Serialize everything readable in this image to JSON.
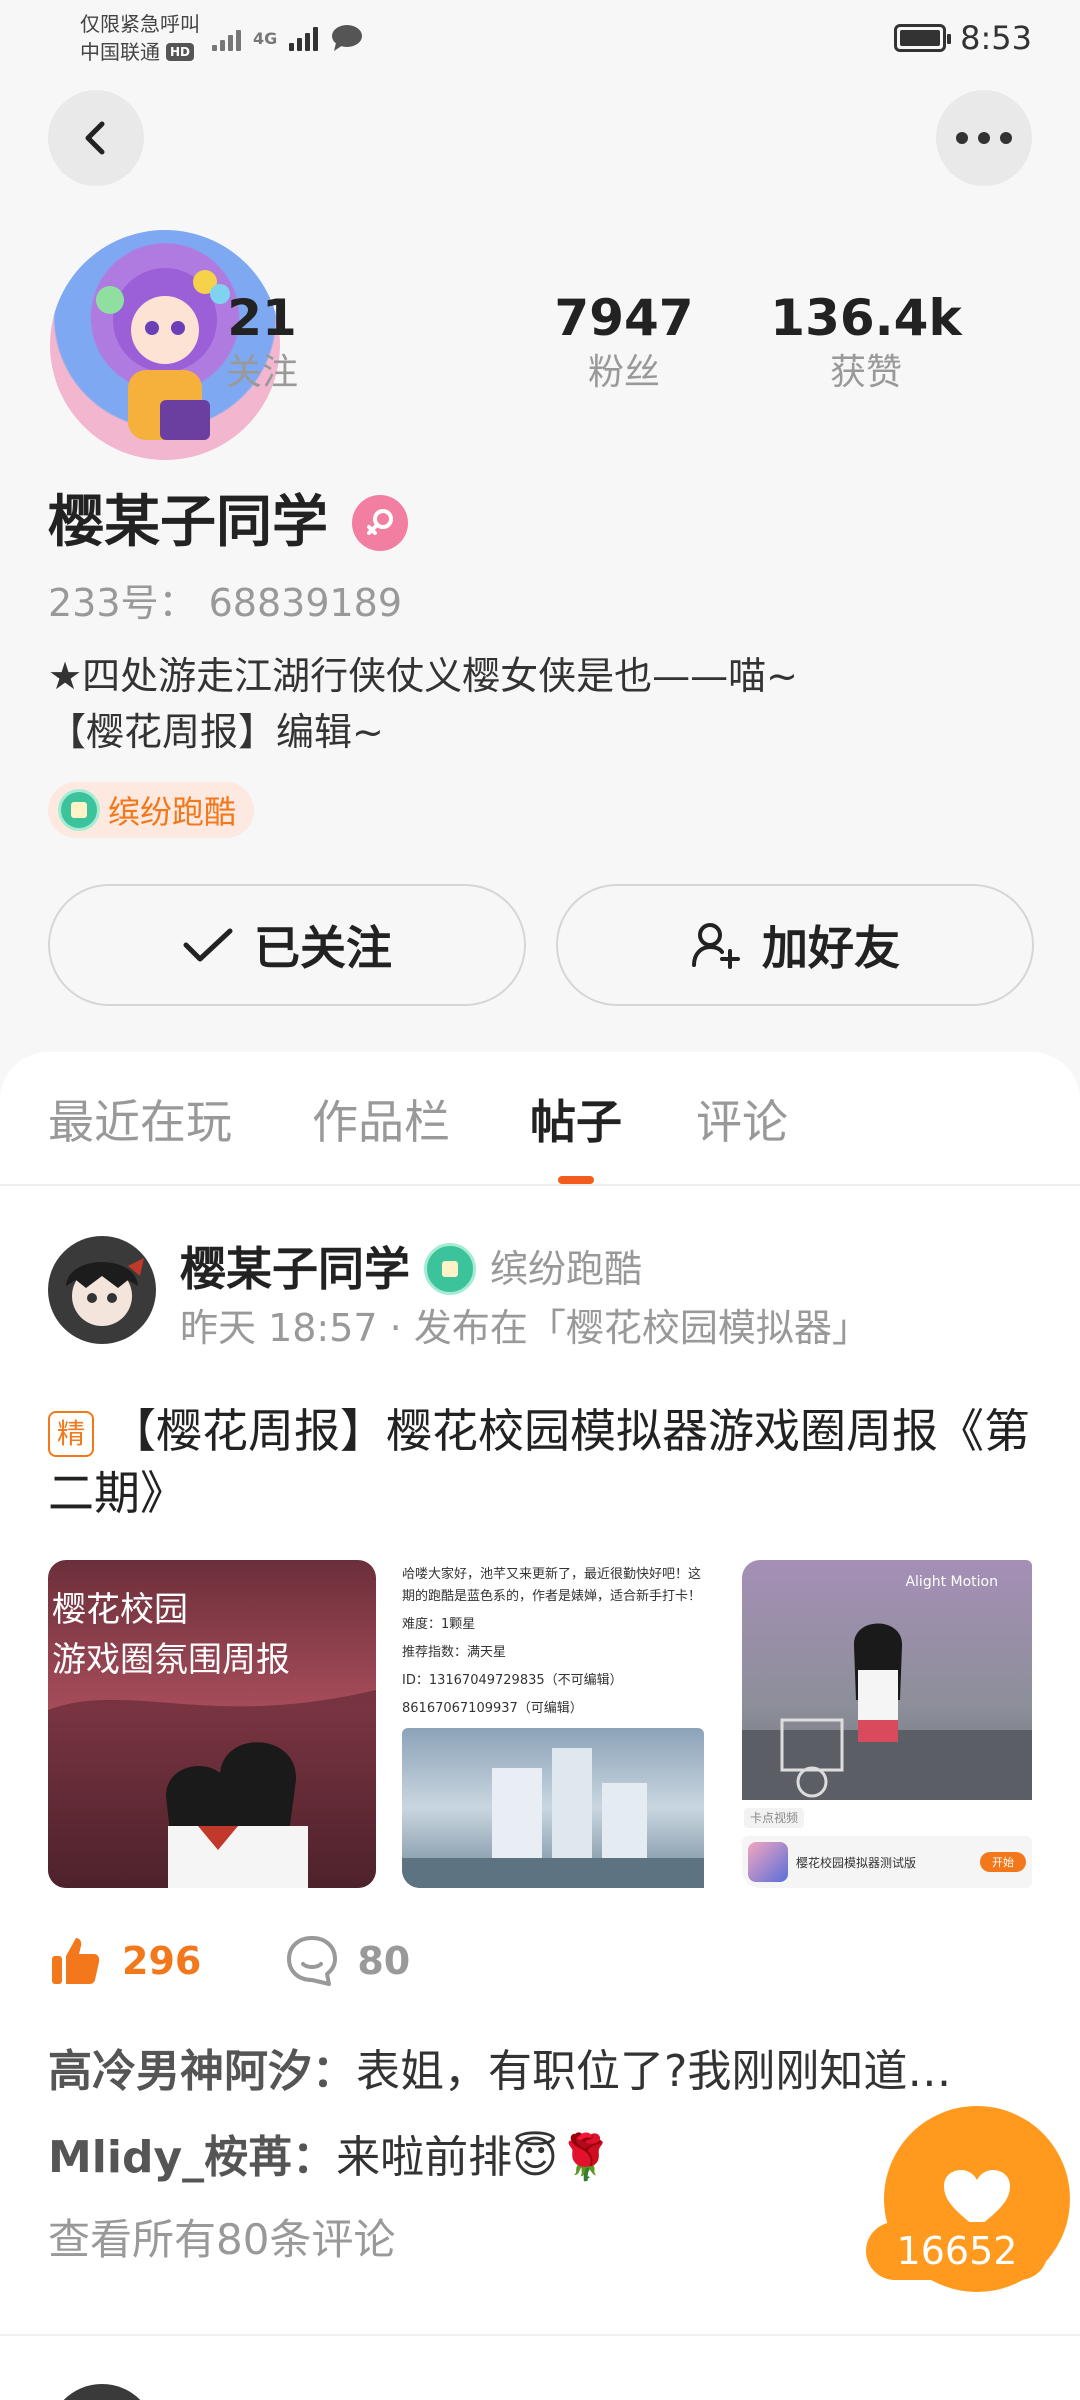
{
  "status_bar": {
    "line1": "仅限紧急呼叫",
    "carrier": "中国联通",
    "hd": "HD",
    "network": "4G",
    "time": "8:53"
  },
  "profile": {
    "stats": [
      {
        "value": "21",
        "label": "关注"
      },
      {
        "value": "7947",
        "label": "粉丝"
      },
      {
        "value": "136.4k",
        "label": "获赞"
      }
    ],
    "name": "樱某子同学",
    "uid": "233号：  68839189",
    "bio_line1": "★四处游走江湖行侠仗义樱女侠是也——喵~",
    "bio_line2": "【樱花周报】编辑~",
    "medal_tag": "缤纷跑酷",
    "follow_button": "已关注",
    "add_friend_button": "加好友"
  },
  "tabs": [
    "最近在玩",
    "作品栏",
    "帖子",
    "评论"
  ],
  "active_tab": "帖子",
  "post": {
    "author": "樱某子同学",
    "author_medal": "缤纷跑酷",
    "meta": "昨天 18:57 · 发布在「樱花校园模拟器」",
    "badge": "精",
    "title": "【樱花周报】樱花校园模拟器游戏圈周报《第二期》",
    "images": {
      "img1_line1": "樱花校园",
      "img1_line2": "游戏圈氛围周报",
      "img2_lines": [
        "哈喽大家好，池芊又来更新了，最近很勤快好吧！这",
        "期的跑酷是蓝色系的，作者是婊婵，适合新手打卡！",
        "难度：1颗星",
        "推荐指数：满天星",
        "ID：13167049729835（不可编辑）",
        "86167067109937（可编辑）"
      ],
      "img3_watermark": "Alight Motion",
      "img3_chip": "卡点视频",
      "img3_game_name": "樱花校园模拟器测试版",
      "img3_game_button": "开始"
    },
    "likes": "296",
    "comments_count": "80",
    "comment1_user": "高冷男神阿汐：",
    "comment1_text": "表姐，有职位了?我刚刚知道…",
    "comment2_user": "Mlidy_桉苒：",
    "comment2_text": "来啦前排😇🌹",
    "view_all": "查看所有80条评论"
  },
  "fab": {
    "count": "16652"
  },
  "colors": {
    "accent": "#f2781b",
    "fab": "#ff9a1f",
    "indicator": "#f25d1b",
    "gender": "#f27ea2"
  }
}
